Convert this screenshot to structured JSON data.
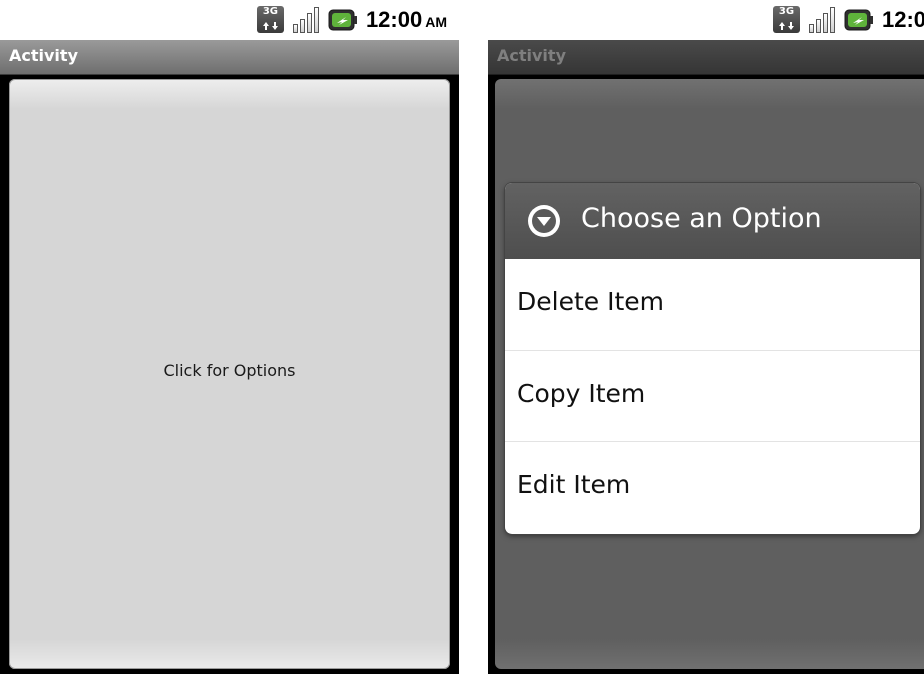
{
  "status_bar": {
    "network_badge": "3G",
    "time": "12:00",
    "ampm": "AM",
    "icons": [
      "network-3g-icon",
      "signal-strength-icon",
      "battery-charging-icon"
    ]
  },
  "left_screen": {
    "title": "Activity",
    "content_button_label": "Click for Options"
  },
  "right_screen": {
    "title": "Activity",
    "dialog": {
      "title": "Choose an Option",
      "icon": "chevron-down-circle-icon",
      "items": [
        {
          "label": "Delete Item"
        },
        {
          "label": "Copy Item"
        },
        {
          "label": "Edit Item"
        }
      ]
    }
  },
  "colors": {
    "title_bar": "#7f7f7f",
    "dialog_header": "#595959",
    "content_light": "#d6d6d6",
    "content_dimmed": "#5f5f5f",
    "battery_accent": "#5fb33b"
  }
}
